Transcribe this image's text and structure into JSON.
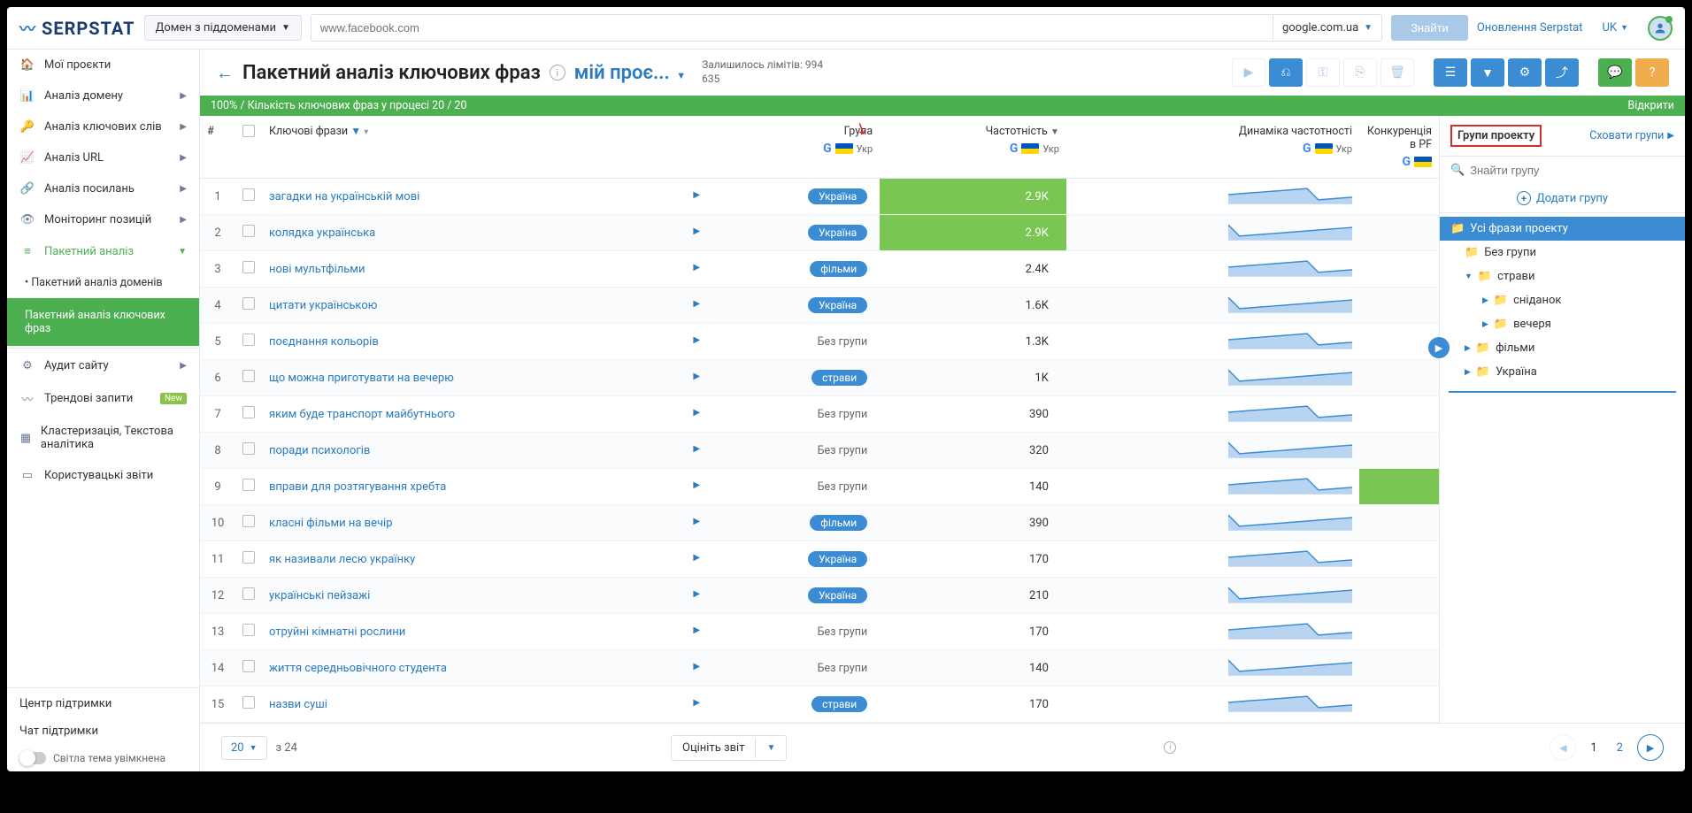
{
  "header": {
    "logo": "SERPSTAT",
    "domain_mode": "Домен з піддоменами",
    "search_placeholder": "www.facebook.com",
    "search_engine": "google.com.ua",
    "find_btn": "Знайти",
    "updates_link": "Оновлення Serpstat",
    "lang": "UK"
  },
  "sidebar": {
    "items": [
      {
        "icon": "🏠",
        "label": "Мої проєкти"
      },
      {
        "icon": "📊",
        "label": "Аналіз домену",
        "chevron": true
      },
      {
        "icon": "🔑",
        "label": "Аналіз ключових слів",
        "chevron": true
      },
      {
        "icon": "📈",
        "label": "Аналіз URL",
        "chevron": true
      },
      {
        "icon": "🔗",
        "label": "Аналіз посилань",
        "chevron": true
      },
      {
        "icon": "👁",
        "label": "Моніторинг позицій",
        "chevron": true
      },
      {
        "icon": "≡",
        "label": "Пакетний аналіз",
        "chevron": true,
        "active": true
      }
    ],
    "subs": [
      {
        "label": "Пакетний аналіз доменів"
      },
      {
        "label": "Пакетний аналіз ключових фраз",
        "selected": true
      }
    ],
    "lower": [
      {
        "icon": "⚙",
        "label": "Аудит сайту",
        "chevron": true
      },
      {
        "icon": "〰",
        "label": "Трендові запити",
        "badge": "New"
      },
      {
        "icon": "▦",
        "label": "Кластеризація, Текстова аналітика"
      },
      {
        "icon": "▭",
        "label": "Користувацькі звіти"
      }
    ],
    "footer": {
      "support_center": "Центр підтримки",
      "chat": "Чат підтримки",
      "theme": "Світла тема увімкнена"
    }
  },
  "page": {
    "title": "Пакетний аналіз ключових фраз",
    "project": "мій проє...",
    "limits_label": "Залишилось лімітів: 994",
    "limits_sub": "635",
    "progress": "100% / Кількість ключових фраз у процесі 20 / 20",
    "progress_open": "Відкрити"
  },
  "columns": {
    "num": "#",
    "keywords": "Ключові фрази",
    "group": "Група",
    "freq": "Частотність",
    "dyn": "Динаміка частотності",
    "comp": "Конкуренція в PF",
    "se_label": "Укр"
  },
  "rows": [
    {
      "n": 1,
      "kw": "загадки на українській мові",
      "group": "Україна",
      "group_type": "pill",
      "freq": "2.9K",
      "hl": true
    },
    {
      "n": 2,
      "kw": "колядка українська",
      "group": "Україна",
      "group_type": "pill",
      "freq": "2.9K",
      "hl": true
    },
    {
      "n": 3,
      "kw": "нові мультфільми",
      "group": "фільми",
      "group_type": "pill",
      "freq": "2.4K"
    },
    {
      "n": 4,
      "kw": "цитати українською",
      "group": "Україна",
      "group_type": "pill",
      "freq": "1.6K"
    },
    {
      "n": 5,
      "kw": "поєднання кольорів",
      "group": "Без групи",
      "group_type": "none",
      "freq": "1.3K"
    },
    {
      "n": 6,
      "kw": "що можна приготувати на вечерю",
      "group": "страви",
      "group_type": "pill",
      "freq": "1K"
    },
    {
      "n": 7,
      "kw": "яким буде транспорт майбутнього",
      "group": "Без групи",
      "group_type": "none",
      "freq": "390"
    },
    {
      "n": 8,
      "kw": "поради психологів",
      "group": "Без групи",
      "group_type": "none",
      "freq": "320"
    },
    {
      "n": 9,
      "kw": "вправи для розтягування хребта",
      "group": "Без групи",
      "group_type": "none",
      "freq": "140",
      "hl_comp": true
    },
    {
      "n": 10,
      "kw": "класні фільми на вечір",
      "group": "фільми",
      "group_type": "pill",
      "freq": "390"
    },
    {
      "n": 11,
      "kw": "як називали лесю українку",
      "group": "Україна",
      "group_type": "pill",
      "freq": "170"
    },
    {
      "n": 12,
      "kw": "українські пейзажі",
      "group": "Україна",
      "group_type": "pill",
      "freq": "210"
    },
    {
      "n": 13,
      "kw": "отруйні кімнатні рослини",
      "group": "Без групи",
      "group_type": "none",
      "freq": "170"
    },
    {
      "n": 14,
      "kw": "життя середньовічного студента",
      "group": "Без групи",
      "group_type": "none",
      "freq": "140"
    },
    {
      "n": 15,
      "kw": "назви суші",
      "group": "страви",
      "group_type": "pill",
      "freq": "170"
    }
  ],
  "groups_panel": {
    "title": "Групи проекту",
    "hide": "Сховати групи",
    "search_placeholder": "Знайти групу",
    "add": "Додати групу",
    "tree": [
      {
        "label": "Усі фрази проекту",
        "selected": true,
        "folder": true
      },
      {
        "label": "Без групи",
        "folder": true,
        "indent": 1
      },
      {
        "label": "страви",
        "folder": true,
        "indent": 1,
        "expandable": true,
        "expanded": true
      },
      {
        "label": "сніданок",
        "folder": true,
        "indent": 2,
        "expandable": true
      },
      {
        "label": "вечеря",
        "folder": true,
        "indent": 2,
        "expandable": true
      },
      {
        "label": "фільми",
        "folder": true,
        "indent": 1,
        "expandable": true
      },
      {
        "label": "Україна",
        "folder": true,
        "indent": 1,
        "expandable": true
      }
    ]
  },
  "footer": {
    "page_size": "20",
    "of": "з 24",
    "rate": "Оцініть звіт",
    "current_page": "1",
    "other_page": "2"
  }
}
